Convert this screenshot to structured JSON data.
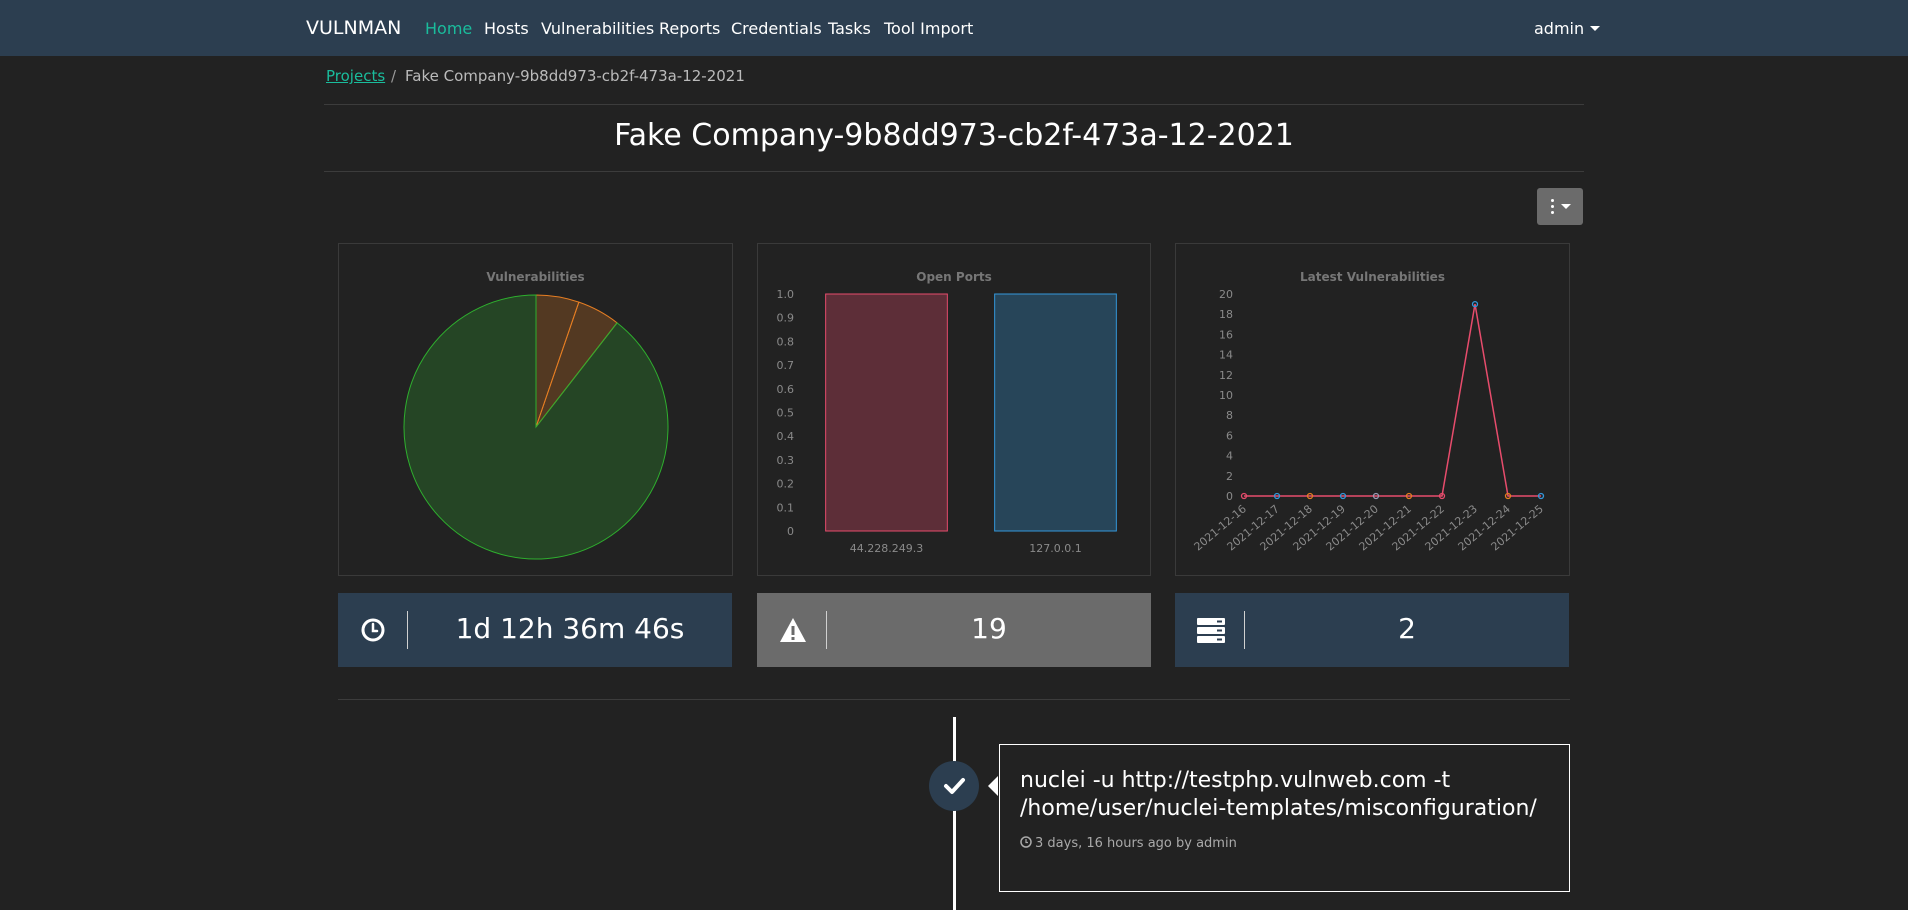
{
  "navbar": {
    "brand": "VULNMAN",
    "items": [
      {
        "label": "Home",
        "active": true
      },
      {
        "label": "Hosts"
      },
      {
        "label": "Vulnerabilities"
      },
      {
        "label": "Reports"
      },
      {
        "label": "Credentials"
      },
      {
        "label": "Tasks"
      },
      {
        "label": "Tool Import"
      }
    ],
    "user": "admin"
  },
  "breadcrumb": {
    "root": "Projects",
    "separator": "/",
    "current": "Fake Company-9b8dd973-cb2f-473a-12-2021"
  },
  "page_title": "Fake Company-9b8dd973-cb2f-473a-12-2021",
  "colors": {
    "navbar": "#2c3e50",
    "accent": "#1abc9c",
    "background": "#222222"
  },
  "chart_data": [
    {
      "type": "pie",
      "title": "Vulnerabilities",
      "slices": [
        {
          "value": 1,
          "color": "#e67e22"
        },
        {
          "value": 1,
          "color": "#e67e22"
        },
        {
          "value": 17,
          "color": "#2eaf2e"
        }
      ]
    },
    {
      "type": "bar",
      "title": "Open Ports",
      "categories": [
        "44.228.249.3",
        "127.0.0.1"
      ],
      "values": [
        1,
        1
      ],
      "colors": [
        "#e74c6c",
        "#3498db"
      ],
      "ylim": [
        0,
        1.0
      ],
      "yticks": [
        "1.0",
        "0.9",
        "0.8",
        "0.7",
        "0.6",
        "0.5",
        "0.4",
        "0.3",
        "0.2",
        "0.1",
        "0"
      ]
    },
    {
      "type": "line",
      "title": "Latest Vulnerabilities",
      "x": [
        "2021-12-16",
        "2021-12-17",
        "2021-12-18",
        "2021-12-19",
        "2021-12-20",
        "2021-12-21",
        "2021-12-22",
        "2021-12-23",
        "2021-12-24",
        "2021-12-25"
      ],
      "values": [
        0,
        0,
        0,
        0,
        0,
        0,
        0,
        19,
        0,
        0
      ],
      "ylim": [
        0,
        20
      ],
      "yticks": [
        "20",
        "18",
        "16",
        "14",
        "12",
        "10",
        "8",
        "6",
        "4",
        "2",
        "0"
      ],
      "line_color": "#e74c6c"
    }
  ],
  "stats": [
    {
      "icon": "clock-icon",
      "value": "1d 12h 36m 46s"
    },
    {
      "icon": "warning-icon",
      "value": "19"
    },
    {
      "icon": "server-icon",
      "value": "2"
    }
  ],
  "timeline": [
    {
      "command": "nuclei -u http://testphp.vulnweb.com -t /home/user/nuclei-templates/misconfiguration/",
      "meta": "3 days, 16 hours ago by admin"
    }
  ]
}
